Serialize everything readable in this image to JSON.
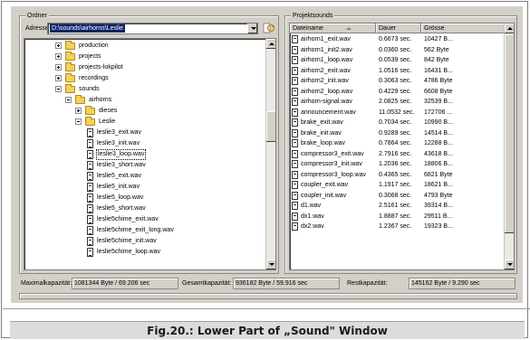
{
  "folder_panel": {
    "title": "Ordner",
    "address_label": "Adresse:",
    "address_value": "D:\\sounds\\airhorns\\Leslie"
  },
  "tree": [
    {
      "label": "production",
      "level": 1,
      "kind": "folder",
      "expander": "plus"
    },
    {
      "label": "projects",
      "level": 1,
      "kind": "folder",
      "expander": "plus"
    },
    {
      "label": "projects-lokpilot",
      "level": 1,
      "kind": "folder",
      "expander": "plus"
    },
    {
      "label": "recordings",
      "level": 1,
      "kind": "folder",
      "expander": "plus"
    },
    {
      "label": "sounds",
      "level": 1,
      "kind": "folder",
      "expander": "minus"
    },
    {
      "label": "airhorns",
      "level": 2,
      "kind": "folder",
      "expander": "minus"
    },
    {
      "label": "dieses",
      "level": 3,
      "kind": "folder",
      "expander": "plus"
    },
    {
      "label": "Leslie",
      "level": 3,
      "kind": "folder",
      "expander": "minus"
    },
    {
      "label": "leslie3_exit.wav",
      "level": 4,
      "kind": "file"
    },
    {
      "label": "leslie3_init.wav",
      "level": 4,
      "kind": "file"
    },
    {
      "label": "leslie3_loop.wav",
      "level": 4,
      "kind": "file",
      "selected": true
    },
    {
      "label": "leslie3_short.wav",
      "level": 4,
      "kind": "file"
    },
    {
      "label": "leslie5_exit.wav",
      "level": 4,
      "kind": "file"
    },
    {
      "label": "leslie5_init.wav",
      "level": 4,
      "kind": "file"
    },
    {
      "label": "leslie5_loop.wav",
      "level": 4,
      "kind": "file"
    },
    {
      "label": "leslie5_short.wav",
      "level": 4,
      "kind": "file"
    },
    {
      "label": "leslie5chime_exit.wav",
      "level": 4,
      "kind": "file"
    },
    {
      "label": "leslie5chime_exit_long.wav",
      "level": 4,
      "kind": "file"
    },
    {
      "label": "leslie5chime_init.wav",
      "level": 4,
      "kind": "file"
    },
    {
      "label": "leslie5chime_loop.wav",
      "level": 4,
      "kind": "file"
    }
  ],
  "projectsounds": {
    "title": "Projektsounds",
    "columns": [
      "Dateiname",
      "Dauer",
      "Grösse"
    ],
    "rows": [
      [
        "airhorn1_exit.wav",
        "0.6673 sec.",
        "10427 B..."
      ],
      [
        "airhorn1_init2.wav",
        "0.0360 sec.",
        "562 Byte"
      ],
      [
        "airhorn1_loop.wav",
        "0.0539 sec.",
        "842 Byte"
      ],
      [
        "airhorn2_exit.wav",
        "1.0516 sec.",
        "16431 B..."
      ],
      [
        "airhorn2_init.wav",
        "0.3063 sec.",
        "4786 Byte"
      ],
      [
        "airhorn2_loop.wav",
        "0.4229 sec.",
        "6608 Byte"
      ],
      [
        "airhorn-signal.wav",
        "2.0825 sec.",
        "32539 B..."
      ],
      [
        "announcement.wav",
        "11.0532 sec.",
        "172706 ..."
      ],
      [
        "brake_exit.wav",
        "0.7034 sec.",
        "10990 B..."
      ],
      [
        "brake_init.wav",
        "0.9289 sec.",
        "14514 B..."
      ],
      [
        "brake_loop.wav",
        "0.7864 sec.",
        "12288 B..."
      ],
      [
        "compressor3_exit.wav",
        "2.7916 sec.",
        "43618 B..."
      ],
      [
        "compressor3_init.wav",
        "1.2036 sec.",
        "18806 B..."
      ],
      [
        "compressor3_loop.wav",
        "0.4365 sec.",
        "6821 Byte"
      ],
      [
        "coupler_exit.wav",
        "1.1917 sec.",
        "18621 B..."
      ],
      [
        "coupler_init.wav",
        "0.3068 sec.",
        "4793 Byte"
      ],
      [
        "d1.wav",
        "2.5161 sec.",
        "39314 B..."
      ],
      [
        "dx1.wav",
        "1.8887 sec.",
        "29511 B..."
      ],
      [
        "dx2.wav",
        "1.2367 sec.",
        "19323 B..."
      ]
    ]
  },
  "status": {
    "max_label": "Maximalkapazität:",
    "max_value": "1081344 Byte / 69.206 sec",
    "total_label": "Gesamtkapazität:",
    "total_value": "936182 Byte / 59.916 sec",
    "rest_label": "Restkapazität:",
    "rest_value": "145162 Byte / 9.290 sec"
  },
  "caption": "Fig.20.: Lower Part of „Sound\" Window",
  "icons": [
    "dropdown-arrow-icon",
    "refresh-icon",
    "folder-icon",
    "wav-file-icon",
    "expander-icon",
    "sort-arrow-icon",
    "scroll-up-icon",
    "scroll-down-icon"
  ]
}
